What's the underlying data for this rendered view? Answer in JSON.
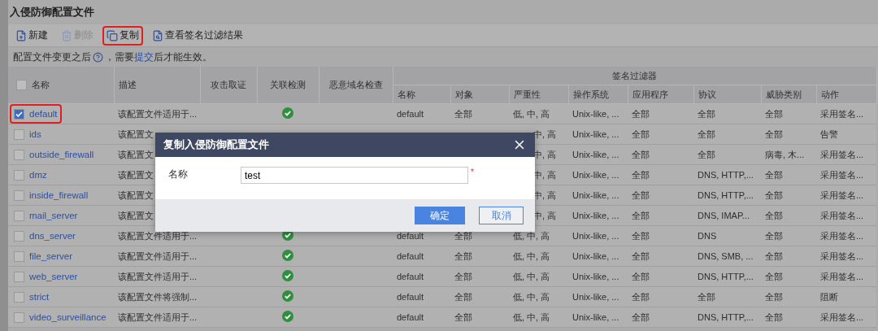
{
  "page_title": "入侵防御配置文件",
  "toolbar": [
    {
      "kind": "new",
      "label": "新建",
      "disabled": false,
      "highlighted": false
    },
    {
      "kind": "delete",
      "label": "删除",
      "disabled": true,
      "highlighted": false
    },
    {
      "kind": "copy",
      "label": "复制",
      "disabled": false,
      "highlighted": true
    },
    {
      "kind": "view",
      "label": "查看签名过滤结果",
      "disabled": false,
      "highlighted": false
    }
  ],
  "notice": {
    "before": "配置文件变更之后",
    "middle": "，需要",
    "link": "提交",
    "after": "后才能生效。"
  },
  "table": {
    "columns": [
      "名称",
      "描述",
      "攻击取证",
      "关联检测",
      "恶意域名检查"
    ],
    "select_all_checked": false,
    "group": "签名过滤器",
    "sub_columns": [
      "名称",
      "对象",
      "严重性",
      "操作系统",
      "应用程序",
      "协议",
      "威胁类别",
      "动作"
    ],
    "rows": [
      {
        "name": "default",
        "checked": true,
        "highlighted": true,
        "description": "该配置文件适用于...",
        "correlation": true,
        "cells": [
          "default",
          "全部",
          "低, 中, 高",
          "Unix-like, ...",
          "全部",
          "全部",
          "全部",
          "采用签名..."
        ]
      },
      {
        "name": "ids",
        "checked": false,
        "highlighted": false,
        "description": "该配置文",
        "cells": [
          null,
          null,
          "中, 高",
          "Unix-like, ...",
          "全部",
          "全部",
          "全部",
          "告警"
        ]
      },
      {
        "name": "outside_firewall",
        "checked": false,
        "highlighted": false,
        "description": "该配置文",
        "cells": [
          null,
          null,
          "中, 高",
          "Unix-like, ...",
          "全部",
          "全部",
          "病毒, 木...",
          "采用签名..."
        ]
      },
      {
        "name": "dmz",
        "checked": false,
        "highlighted": false,
        "description": "该配置文",
        "cells": [
          null,
          null,
          "中, 高",
          "Unix-like, ...",
          "全部",
          "DNS, HTTP,...",
          "全部",
          "采用签名..."
        ]
      },
      {
        "name": "inside_firewall",
        "checked": false,
        "highlighted": false,
        "description": "该配置文",
        "cells": [
          null,
          null,
          "中, 高",
          "Unix-like, ...",
          "全部",
          "DNS, HTTP,...",
          "全部",
          "采用签名..."
        ]
      },
      {
        "name": "mail_server",
        "checked": false,
        "highlighted": false,
        "description": "该配置文",
        "cells": [
          null,
          null,
          "中, 高",
          "Unix-like, ...",
          "全部",
          "DNS, IMAP...",
          "全部",
          "采用签名..."
        ]
      },
      {
        "name": "dns_server",
        "checked": false,
        "highlighted": false,
        "description": "该配置文件适用于...",
        "correlation": true,
        "cells": [
          "default",
          "全部",
          "低, 中, 高",
          "Unix-like, ...",
          "全部",
          "DNS",
          "全部",
          "采用签名..."
        ]
      },
      {
        "name": "file_server",
        "checked": false,
        "highlighted": false,
        "description": "该配置文件适用于...",
        "correlation": true,
        "cells": [
          "default",
          "全部",
          "低, 中, 高",
          "Unix-like, ...",
          "全部",
          "DNS, SMB, ...",
          "全部",
          "采用签名..."
        ]
      },
      {
        "name": "web_server",
        "checked": false,
        "highlighted": false,
        "description": "该配置文件适用于...",
        "correlation": true,
        "cells": [
          "default",
          "全部",
          "低, 中, 高",
          "Unix-like, ...",
          "全部",
          "DNS, HTTP,...",
          "全部",
          "采用签名..."
        ]
      },
      {
        "name": "strict",
        "checked": false,
        "highlighted": false,
        "description": "该配置文件将强制...",
        "correlation": true,
        "cells": [
          "default",
          "全部",
          "低, 中, 高",
          "Unix-like, ...",
          "全部",
          "全部",
          "全部",
          "阻断"
        ]
      },
      {
        "name": "video_surveillance",
        "checked": false,
        "highlighted": false,
        "description": "该配置文件适用于...",
        "correlation": true,
        "cells": [
          "default",
          "全部",
          "低, 中, 高",
          "Unix-like, ...",
          "全部",
          "DNS, HTTP,...",
          "全部",
          "采用签名..."
        ]
      }
    ]
  },
  "dialog": {
    "title": "复制入侵防御配置文件",
    "field_label": "名称",
    "value": "test",
    "required_mark": "*",
    "buttons": [
      {
        "kind": "primary",
        "label": "确定"
      },
      {
        "kind": "secondary",
        "label": "取消"
      }
    ]
  }
}
